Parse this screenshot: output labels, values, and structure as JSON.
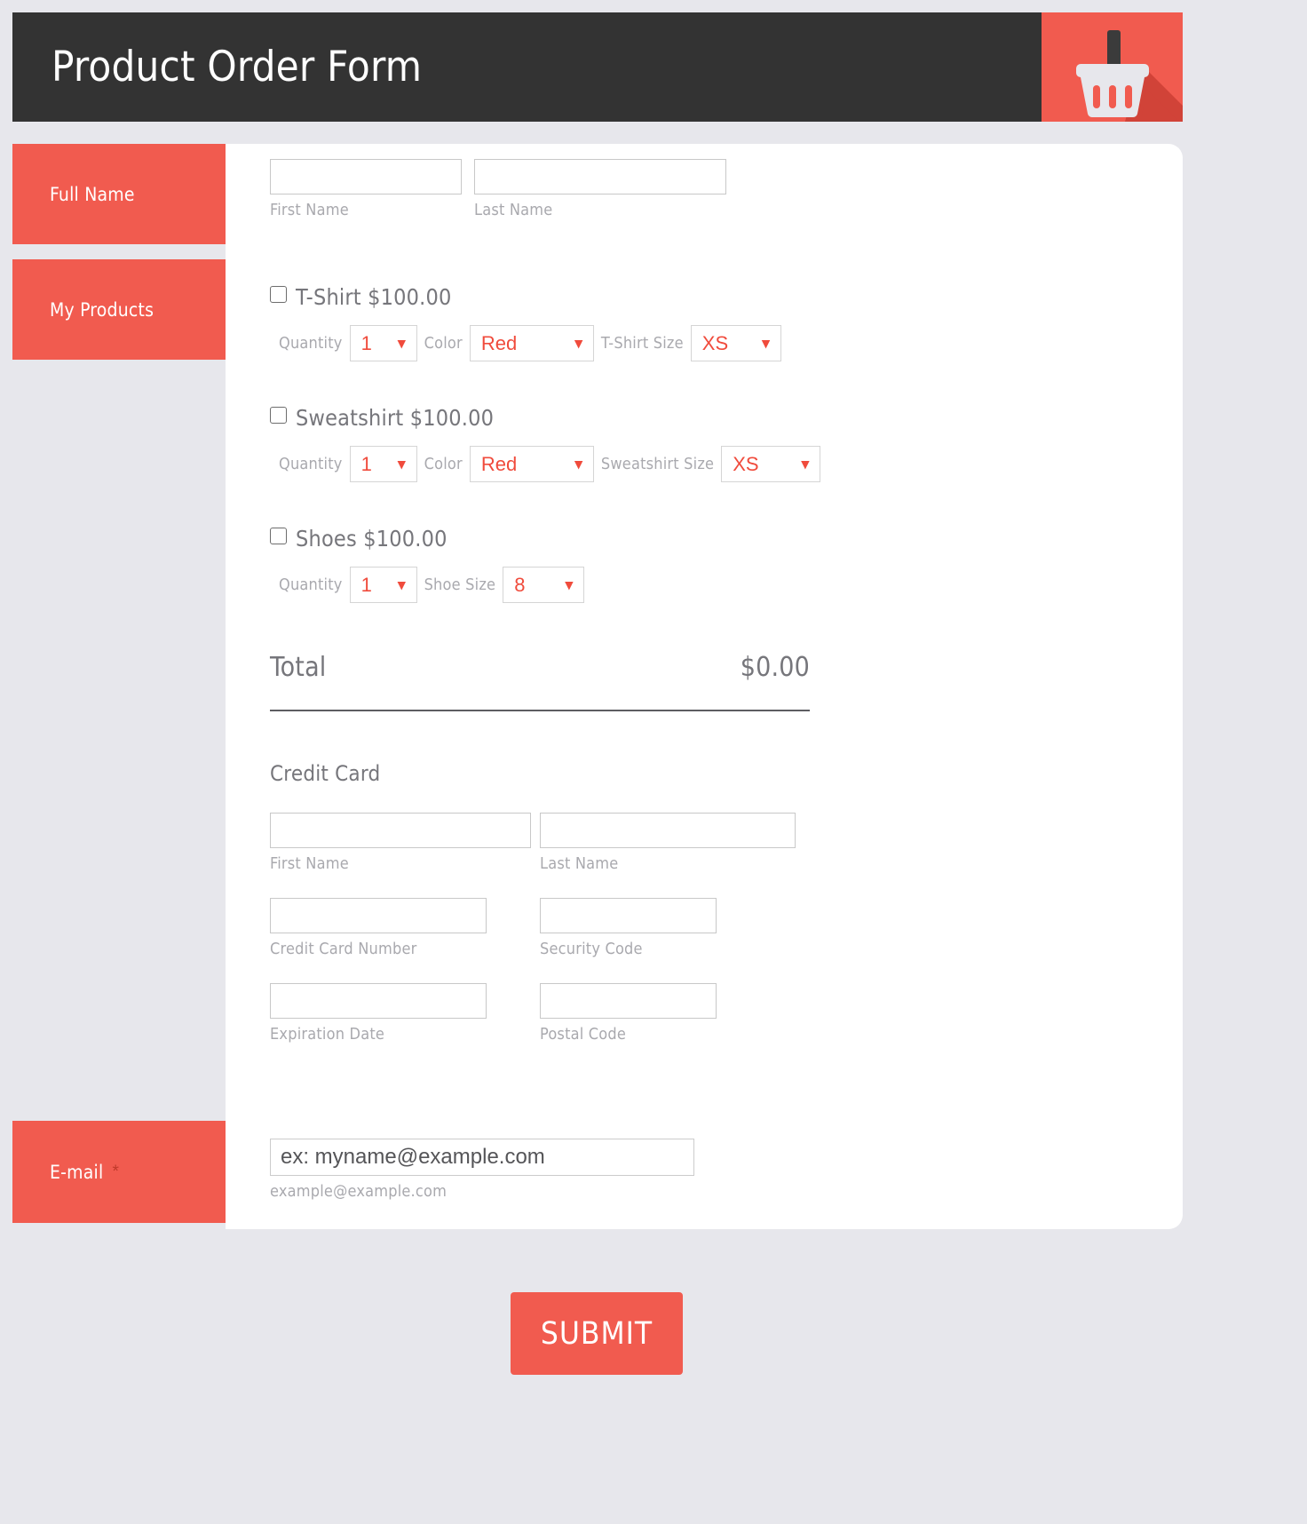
{
  "header": {
    "title": "Product Order Form",
    "icon": "shopping-basket-icon",
    "bar_color": "#333333",
    "accent_color": "#f15b4f"
  },
  "sidebar": {
    "items": [
      {
        "label": "Full Name",
        "required_mark": ""
      },
      {
        "label": "My Products",
        "required_mark": ""
      },
      {
        "label": "E-mail",
        "required_mark": "*"
      }
    ]
  },
  "full_name": {
    "first_sublabel": "First Name",
    "last_sublabel": "Last Name",
    "first_value": "",
    "last_value": ""
  },
  "products": [
    {
      "id": "tshirt",
      "name": "T-Shirt $100.00",
      "checked": false,
      "quantity_label": "Quantity",
      "quantity_value": "1",
      "color_label": "Color",
      "color_value": "Red",
      "size_label": "T-Shirt Size",
      "size_value": "XS"
    },
    {
      "id": "sweatshirt",
      "name": "Sweatshirt $100.00",
      "checked": false,
      "quantity_label": "Quantity",
      "quantity_value": "1",
      "color_label": "Color",
      "color_value": "Red",
      "size_label": "Sweatshirt Size",
      "size_value": "XS"
    },
    {
      "id": "shoes",
      "name": "Shoes $100.00",
      "checked": false,
      "quantity_label": "Quantity",
      "quantity_value": "1",
      "size_label": "Shoe Size",
      "size_value": "8"
    }
  ],
  "total": {
    "label": "Total",
    "value": "$0.00"
  },
  "credit_card": {
    "title": "Credit Card",
    "first_name_sublabel": "First Name",
    "last_name_sublabel": "Last Name",
    "card_number_sublabel": "Credit Card Number",
    "security_code_sublabel": "Security Code",
    "expiration_sublabel": "Expiration Date",
    "postal_sublabel": "Postal Code",
    "first_name_value": "",
    "last_name_value": "",
    "card_number_value": "",
    "security_code_value": "",
    "expiration_value": "",
    "postal_value": ""
  },
  "email": {
    "placeholder": "ex: myname@example.com",
    "value": "",
    "sublabel": "example@example.com"
  },
  "submit": {
    "label": "SUBMIT"
  },
  "icons": {
    "chevron_down": "❯"
  }
}
